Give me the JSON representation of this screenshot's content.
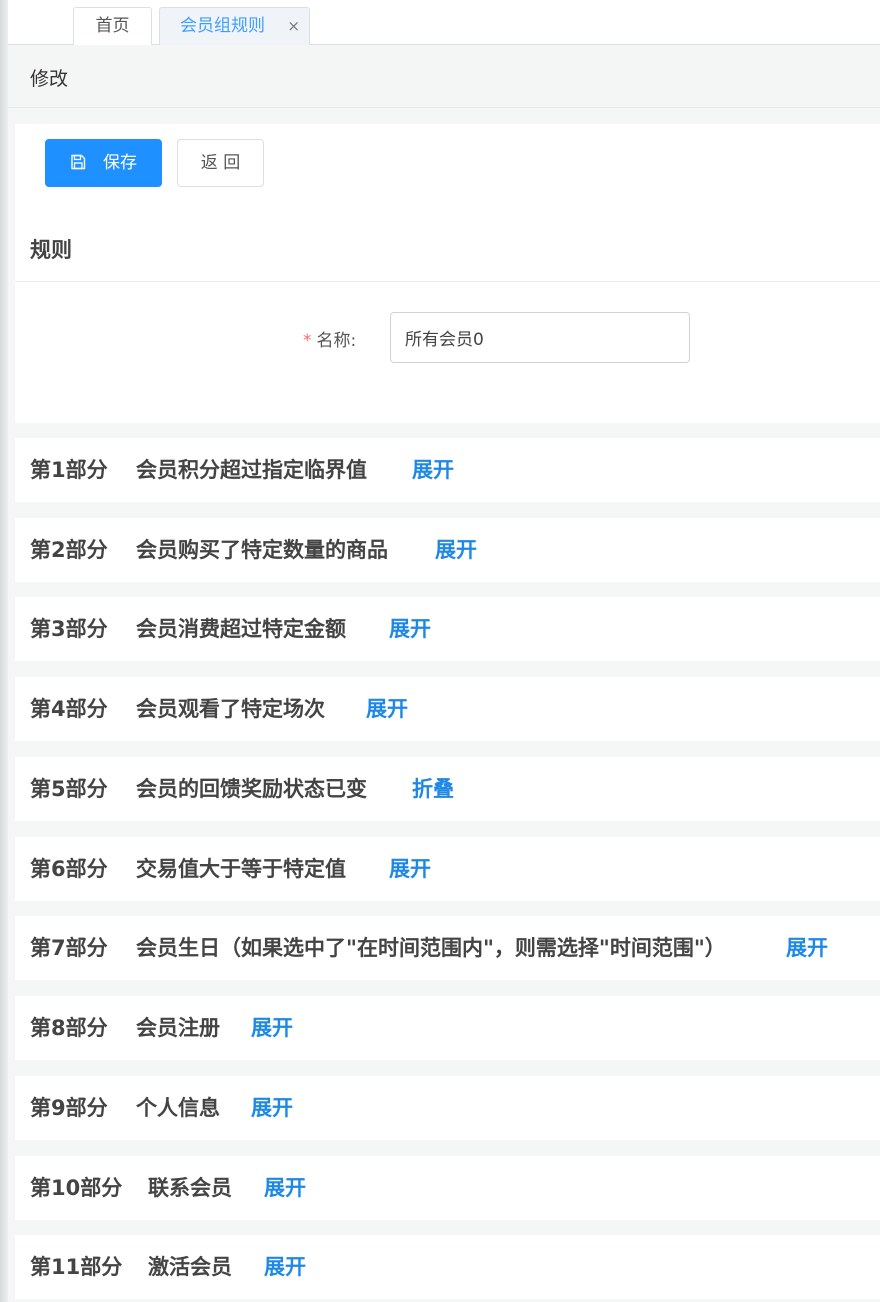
{
  "tabs": [
    {
      "label": "首页"
    },
    {
      "label": "会员组规则",
      "close": "×"
    }
  ],
  "header": {
    "title": "修改"
  },
  "toolbar": {
    "save_label": "保存",
    "back_label": "返 回"
  },
  "rule": {
    "title": "规则",
    "name_label": "名称:",
    "required_mark": "*",
    "name_value": "所有会员0"
  },
  "sections": [
    {
      "no": "第1部分",
      "title": "会员积分超过指定临界值",
      "toggle": "展开"
    },
    {
      "no": "第2部分",
      "title": "会员购买了特定数量的商品",
      "toggle": "展开"
    },
    {
      "no": "第3部分",
      "title": "会员消费超过特定金额",
      "toggle": "展开"
    },
    {
      "no": "第4部分",
      "title": "会员观看了特定场次",
      "toggle": "展开"
    },
    {
      "no": "第5部分",
      "title": "会员的回馈奖励状态已变",
      "toggle": "折叠"
    },
    {
      "no": "第6部分",
      "title": "交易值大于等于特定值",
      "toggle": "展开"
    },
    {
      "no": "第7部分",
      "title": "会员生日（如果选中了\"在时间范围内\"，则需选择\"时间范围\"）",
      "toggle": "展开"
    },
    {
      "no": "第8部分",
      "title": "会员注册",
      "toggle": "展开"
    },
    {
      "no": "第9部分",
      "title": "个人信息",
      "toggle": "展开"
    },
    {
      "no": "第10部分",
      "title": "联系会员",
      "toggle": "展开"
    },
    {
      "no": "第11部分",
      "title": "激活会员",
      "toggle": "展开"
    }
  ]
}
